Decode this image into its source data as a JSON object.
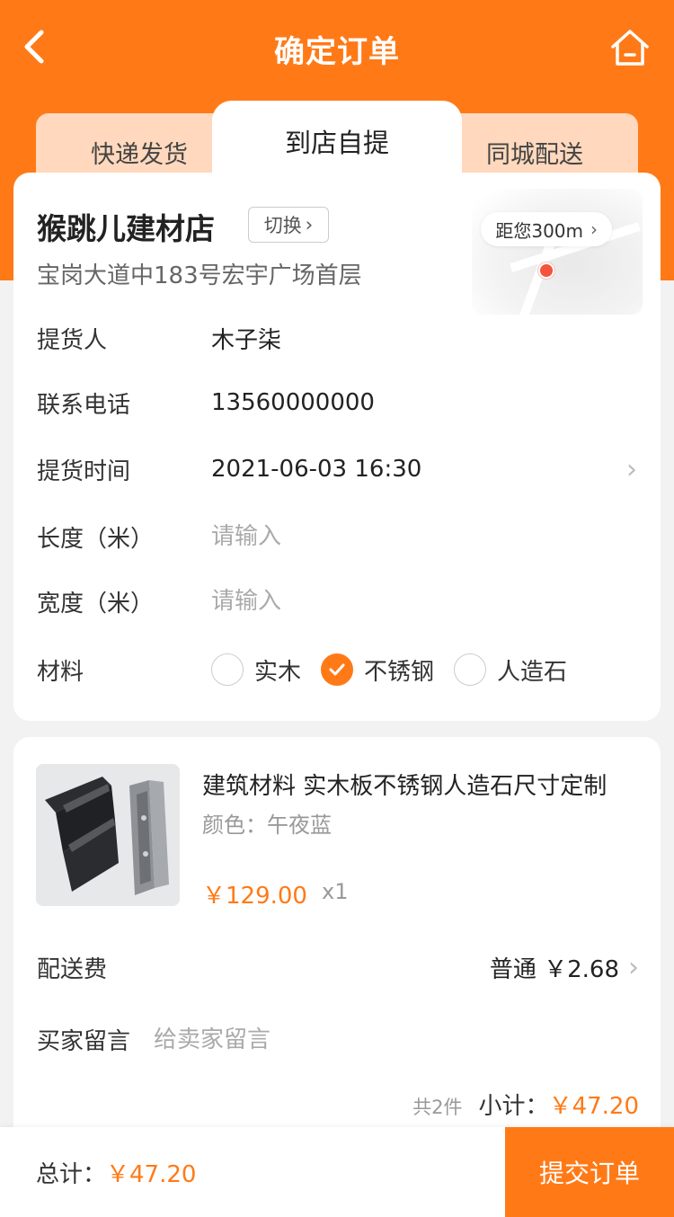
{
  "header": {
    "title": "确定订单",
    "back_icon": "chevron-left-icon",
    "home_icon": "home-icon"
  },
  "tabs": {
    "left": "快递发货",
    "active": "到店自提",
    "right": "同城配送"
  },
  "store": {
    "name": "猴跳儿建材店",
    "switch_label": "切换",
    "address": "宝岗大道中183号宏宇广场首层",
    "distance": "距您300m",
    "distance_chevron": "›"
  },
  "form": {
    "picker_label": "提货人",
    "picker_value": "木子柒",
    "phone_label": "联系电话",
    "phone_value": "13560000000",
    "time_label": "提货时间",
    "time_value": "2021-06-03 16:30",
    "time_arrow": "›",
    "length_label": "长度（米）",
    "length_placeholder": "请输入",
    "width_label": "宽度（米）",
    "width_placeholder": "请输入",
    "material_label": "材料",
    "material_options": [
      "实木",
      "不锈钢",
      "人造石"
    ],
    "material_selected": "不锈钢"
  },
  "goods": {
    "title": "建筑材料 实木板不锈钢人造石尺寸定制",
    "spec": "颜色：午夜蓝",
    "price": "￥129.00",
    "qty": "x1",
    "shipping_label": "配送费",
    "shipping_value": "普通 ￥2.68",
    "shipping_arrow": "›",
    "note_label": "买家留言",
    "note_placeholder": "给卖家留言",
    "count": "共2件",
    "subtotal_label": "小计：",
    "subtotal_value": "￥47.20"
  },
  "footer": {
    "total_label": "总计：",
    "total_value": "￥47.20",
    "submit_label": "提交订单"
  },
  "colors": {
    "accent": "#ff7a17",
    "tab_inactive": "#ffd8bd",
    "pin": "#f4533c"
  }
}
